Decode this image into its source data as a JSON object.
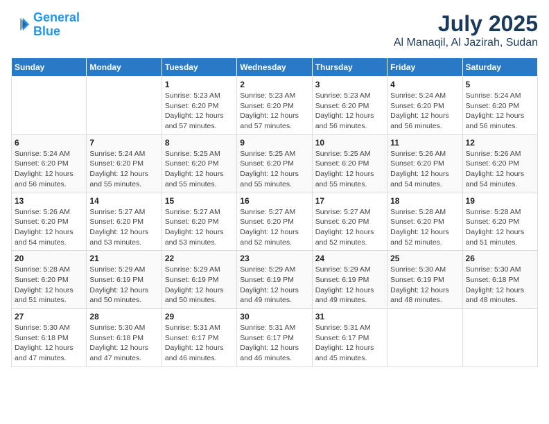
{
  "header": {
    "logo_line1": "General",
    "logo_line2": "Blue",
    "title": "July 2025",
    "subtitle": "Al Manaqil, Al Jazirah, Sudan"
  },
  "days_of_week": [
    "Sunday",
    "Monday",
    "Tuesday",
    "Wednesday",
    "Thursday",
    "Friday",
    "Saturday"
  ],
  "weeks": [
    [
      {
        "day": "",
        "info": ""
      },
      {
        "day": "",
        "info": ""
      },
      {
        "day": "1",
        "info": "Sunrise: 5:23 AM\nSunset: 6:20 PM\nDaylight: 12 hours\nand 57 minutes."
      },
      {
        "day": "2",
        "info": "Sunrise: 5:23 AM\nSunset: 6:20 PM\nDaylight: 12 hours\nand 57 minutes."
      },
      {
        "day": "3",
        "info": "Sunrise: 5:23 AM\nSunset: 6:20 PM\nDaylight: 12 hours\nand 56 minutes."
      },
      {
        "day": "4",
        "info": "Sunrise: 5:24 AM\nSunset: 6:20 PM\nDaylight: 12 hours\nand 56 minutes."
      },
      {
        "day": "5",
        "info": "Sunrise: 5:24 AM\nSunset: 6:20 PM\nDaylight: 12 hours\nand 56 minutes."
      }
    ],
    [
      {
        "day": "6",
        "info": "Sunrise: 5:24 AM\nSunset: 6:20 PM\nDaylight: 12 hours\nand 56 minutes."
      },
      {
        "day": "7",
        "info": "Sunrise: 5:24 AM\nSunset: 6:20 PM\nDaylight: 12 hours\nand 55 minutes."
      },
      {
        "day": "8",
        "info": "Sunrise: 5:25 AM\nSunset: 6:20 PM\nDaylight: 12 hours\nand 55 minutes."
      },
      {
        "day": "9",
        "info": "Sunrise: 5:25 AM\nSunset: 6:20 PM\nDaylight: 12 hours\nand 55 minutes."
      },
      {
        "day": "10",
        "info": "Sunrise: 5:25 AM\nSunset: 6:20 PM\nDaylight: 12 hours\nand 55 minutes."
      },
      {
        "day": "11",
        "info": "Sunrise: 5:26 AM\nSunset: 6:20 PM\nDaylight: 12 hours\nand 54 minutes."
      },
      {
        "day": "12",
        "info": "Sunrise: 5:26 AM\nSunset: 6:20 PM\nDaylight: 12 hours\nand 54 minutes."
      }
    ],
    [
      {
        "day": "13",
        "info": "Sunrise: 5:26 AM\nSunset: 6:20 PM\nDaylight: 12 hours\nand 54 minutes."
      },
      {
        "day": "14",
        "info": "Sunrise: 5:27 AM\nSunset: 6:20 PM\nDaylight: 12 hours\nand 53 minutes."
      },
      {
        "day": "15",
        "info": "Sunrise: 5:27 AM\nSunset: 6:20 PM\nDaylight: 12 hours\nand 53 minutes."
      },
      {
        "day": "16",
        "info": "Sunrise: 5:27 AM\nSunset: 6:20 PM\nDaylight: 12 hours\nand 52 minutes."
      },
      {
        "day": "17",
        "info": "Sunrise: 5:27 AM\nSunset: 6:20 PM\nDaylight: 12 hours\nand 52 minutes."
      },
      {
        "day": "18",
        "info": "Sunrise: 5:28 AM\nSunset: 6:20 PM\nDaylight: 12 hours\nand 52 minutes."
      },
      {
        "day": "19",
        "info": "Sunrise: 5:28 AM\nSunset: 6:20 PM\nDaylight: 12 hours\nand 51 minutes."
      }
    ],
    [
      {
        "day": "20",
        "info": "Sunrise: 5:28 AM\nSunset: 6:20 PM\nDaylight: 12 hours\nand 51 minutes."
      },
      {
        "day": "21",
        "info": "Sunrise: 5:29 AM\nSunset: 6:19 PM\nDaylight: 12 hours\nand 50 minutes."
      },
      {
        "day": "22",
        "info": "Sunrise: 5:29 AM\nSunset: 6:19 PM\nDaylight: 12 hours\nand 50 minutes."
      },
      {
        "day": "23",
        "info": "Sunrise: 5:29 AM\nSunset: 6:19 PM\nDaylight: 12 hours\nand 49 minutes."
      },
      {
        "day": "24",
        "info": "Sunrise: 5:29 AM\nSunset: 6:19 PM\nDaylight: 12 hours\nand 49 minutes."
      },
      {
        "day": "25",
        "info": "Sunrise: 5:30 AM\nSunset: 6:19 PM\nDaylight: 12 hours\nand 48 minutes."
      },
      {
        "day": "26",
        "info": "Sunrise: 5:30 AM\nSunset: 6:18 PM\nDaylight: 12 hours\nand 48 minutes."
      }
    ],
    [
      {
        "day": "27",
        "info": "Sunrise: 5:30 AM\nSunset: 6:18 PM\nDaylight: 12 hours\nand 47 minutes."
      },
      {
        "day": "28",
        "info": "Sunrise: 5:30 AM\nSunset: 6:18 PM\nDaylight: 12 hours\nand 47 minutes."
      },
      {
        "day": "29",
        "info": "Sunrise: 5:31 AM\nSunset: 6:17 PM\nDaylight: 12 hours\nand 46 minutes."
      },
      {
        "day": "30",
        "info": "Sunrise: 5:31 AM\nSunset: 6:17 PM\nDaylight: 12 hours\nand 46 minutes."
      },
      {
        "day": "31",
        "info": "Sunrise: 5:31 AM\nSunset: 6:17 PM\nDaylight: 12 hours\nand 45 minutes."
      },
      {
        "day": "",
        "info": ""
      },
      {
        "day": "",
        "info": ""
      }
    ]
  ]
}
